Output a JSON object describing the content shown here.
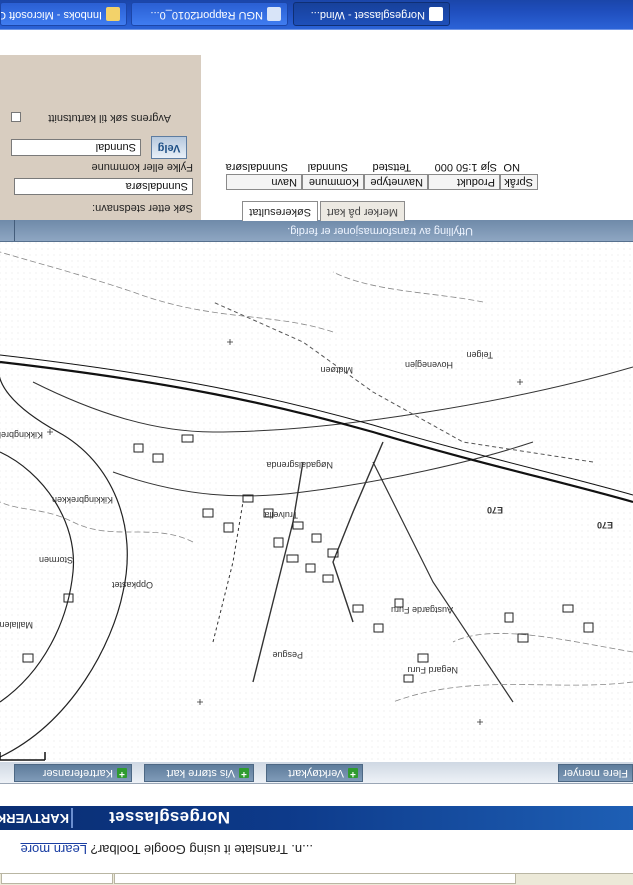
{
  "taskbar": {
    "items": [
      {
        "label": "Norgesglasset - Wind..."
      },
      {
        "label": "NGU Rapport2010_0..."
      },
      {
        "label": "Innboks - Microsoft O..."
      }
    ]
  },
  "browser": {
    "translate_prompt": "Translate it using Google Toolbar?",
    "translate_prefix": "...n.",
    "learn_more": "Learn more"
  },
  "site": {
    "title": "Norgesglasset",
    "brand": "KARTVERK"
  },
  "map_toolbar": {
    "buttons": [
      {
        "label": "Kartreferanser"
      },
      {
        "label": "Vis større kart"
      },
      {
        "label": "Verktøykart"
      }
    ],
    "more_label": "Flere menyer"
  },
  "transform_status": "Utfylling av transformasjoner er ferdig.",
  "search": {
    "place_label": "Søk etter stedsnavn:",
    "place_value": "Sunndalsøra",
    "county_label": "Fylke eller kommune",
    "county_value": "Sunndal",
    "select_label": "Velg",
    "checkbox_label": "Avgrens søk til kartutsnitt"
  },
  "results": {
    "tabs": [
      "Søkeresultat",
      "Merker på kart"
    ],
    "columns": [
      "Navn",
      "Kommune",
      "Navnetype",
      "Produkt",
      "Språk"
    ],
    "rows": [
      [
        "Sunndalsøra",
        "Sunndal",
        "Tettsted",
        "Sjø 1:50 000",
        "NO"
      ]
    ]
  },
  "map": {
    "labels": [
      "Kikkingbrekken",
      "Kikkingbrekken",
      "Hovenegjen",
      "Teigen",
      "Midtøen",
      "Nøgadalsgrenda",
      "Stormen",
      "Oppkastet",
      "Trulvelia",
      "Austgarde Furu",
      "Negard Furu",
      "Pesgue",
      "Mallalen"
    ],
    "roads": [
      "E70",
      "E70"
    ]
  }
}
